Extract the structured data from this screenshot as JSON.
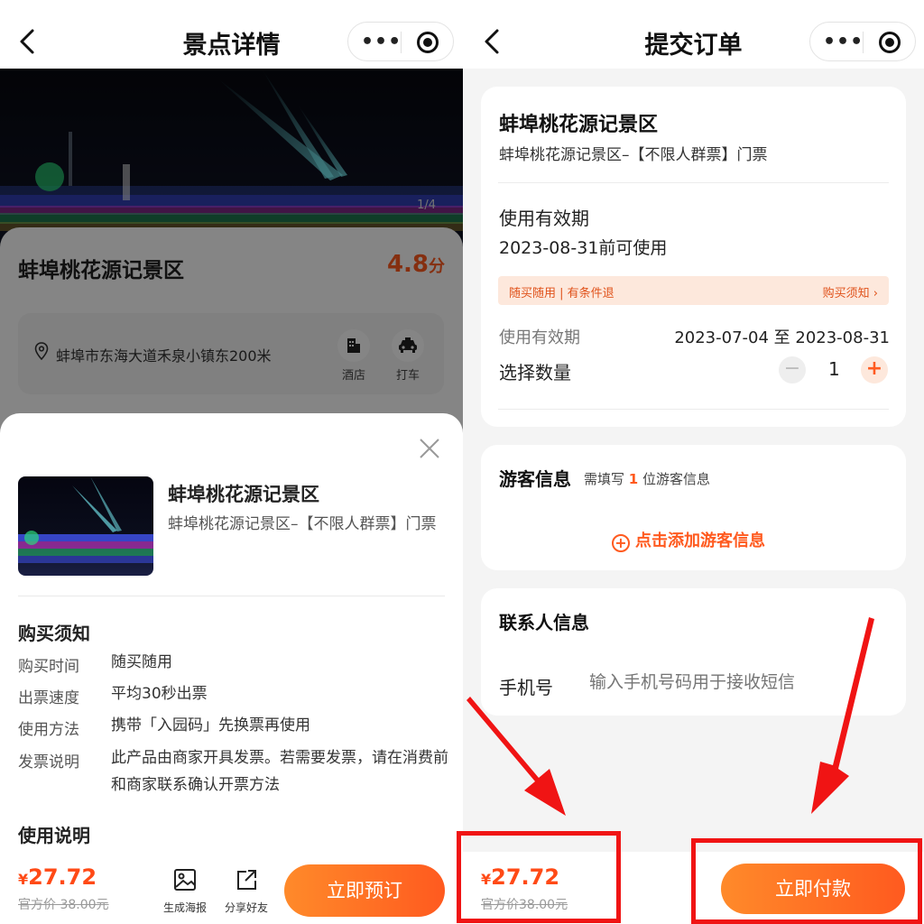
{
  "left": {
    "nav_title": "景点详情",
    "hero_counter": "1/4",
    "spot_name": "蚌埠桃花源记景区",
    "score": "4.8",
    "score_unit": "分",
    "address": "蚌埠市东海大道禾泉小镇东200米",
    "quick_actions": [
      {
        "label": "酒店",
        "icon": "hotel-icon"
      },
      {
        "label": "打车",
        "icon": "taxi-icon"
      }
    ],
    "sheet": {
      "title": "蚌埠桃花源记景区",
      "subtitle": "蚌埠桃花源记景区–【不限人群票】门票",
      "purchase_heading": "购买须知",
      "rows": [
        {
          "k": "购买时间",
          "v": "随买随用"
        },
        {
          "k": "出票速度",
          "v": "平均30秒出票"
        },
        {
          "k": "使用方法",
          "v": "携带「入园码」先换票再使用"
        },
        {
          "k": "发票说明",
          "v": "此产品由商家开具发票。若需要发票，请在消费前和商家联系确认开票方法"
        }
      ],
      "usage_heading": "使用说明"
    },
    "bottom": {
      "yen": "¥",
      "price": "27.72",
      "original": "官方价 38.00元",
      "tool_poster": "生成海报",
      "tool_share": "分享好友",
      "cta": "立即预订"
    }
  },
  "right": {
    "nav_title": "提交订单",
    "product_name": "蚌埠桃花源记景区",
    "product_sub": "蚌埠桃花源记景区–【不限人群票】门票",
    "validity_heading": "使用有效期",
    "validity_text": "2023-08-31前可使用",
    "notice_left": "随买随用 | 有条件退",
    "notice_right": "购买须知 ›",
    "validity_label": "使用有效期",
    "validity_range": "2023-07-04 至 2023-08-31",
    "qty_label": "选择数量",
    "qty_value": "1",
    "visitor_heading": "游客信息",
    "visitor_hint_pre": "需填写",
    "visitor_hint_num": "1",
    "visitor_hint_post": "位游客信息",
    "add_visitor": "点击添加游客信息",
    "contact_heading": "联系人信息",
    "phone_label": "手机号",
    "phone_placeholder": "输入手机号码用于接收短信",
    "bottom": {
      "yen": "¥",
      "price": "27.72",
      "original": "官方价38.00元",
      "cta": "立即付款"
    }
  },
  "colors": {
    "accent": "#ff5a1f",
    "price": "#ff4a16",
    "notice_bg": "#fde8dc",
    "highlight": "#f01414"
  }
}
